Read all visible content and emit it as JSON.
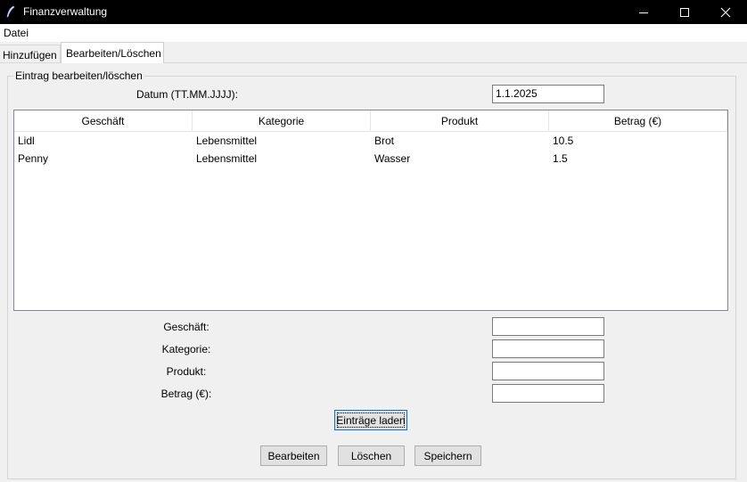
{
  "window": {
    "title": "Finanzverwaltung"
  },
  "menu": {
    "file": "Datei"
  },
  "tabs": {
    "add": "Hinzufügen",
    "edit": "Bearbeiten/Löschen"
  },
  "group": {
    "title": "Eintrag bearbeiten/löschen"
  },
  "date": {
    "label": "Datum (TT.MM.JJJJ):",
    "value": "1.1.2025"
  },
  "table": {
    "headers": [
      "Geschäft",
      "Kategorie",
      "Produkt",
      "Betrag (€)"
    ],
    "rows": [
      [
        "Lidl",
        "Lebensmittel",
        "Brot",
        "10.5"
      ],
      [
        "Penny",
        "Lebensmittel",
        "Wasser",
        "1.5"
      ]
    ]
  },
  "form": {
    "shop_label": "Geschäft:",
    "category_label": "Kategorie:",
    "product_label": "Produkt:",
    "amount_label": "Betrag (€):",
    "shop_value": "",
    "category_value": "",
    "product_value": "",
    "amount_value": ""
  },
  "buttons": {
    "load": "Einträge laden",
    "edit": "Bearbeiten",
    "delete": "Löschen",
    "save": "Speichern"
  }
}
